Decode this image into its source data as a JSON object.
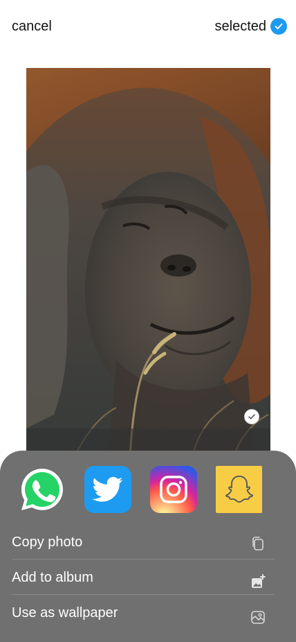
{
  "header": {
    "cancel_label": "cancel",
    "selected_label": "selected"
  },
  "photo": {
    "selected": true
  },
  "share_apps": [
    {
      "name": "whatsapp-icon",
      "color": "#25D366"
    },
    {
      "name": "twitter-icon",
      "color": "#1D9BF0"
    },
    {
      "name": "instagram-icon",
      "color": "#D6249F"
    },
    {
      "name": "snapchat-icon",
      "color": "#F7CD45"
    }
  ],
  "actions": [
    {
      "label": "Copy photo",
      "icon": "copy-icon"
    },
    {
      "label": "Add to album",
      "icon": "add-to-album-icon"
    },
    {
      "label": "Use as wallpaper",
      "icon": "wallpaper-icon"
    }
  ],
  "colors": {
    "accent": "#1d9bf0",
    "sheet_background": "#707070"
  }
}
